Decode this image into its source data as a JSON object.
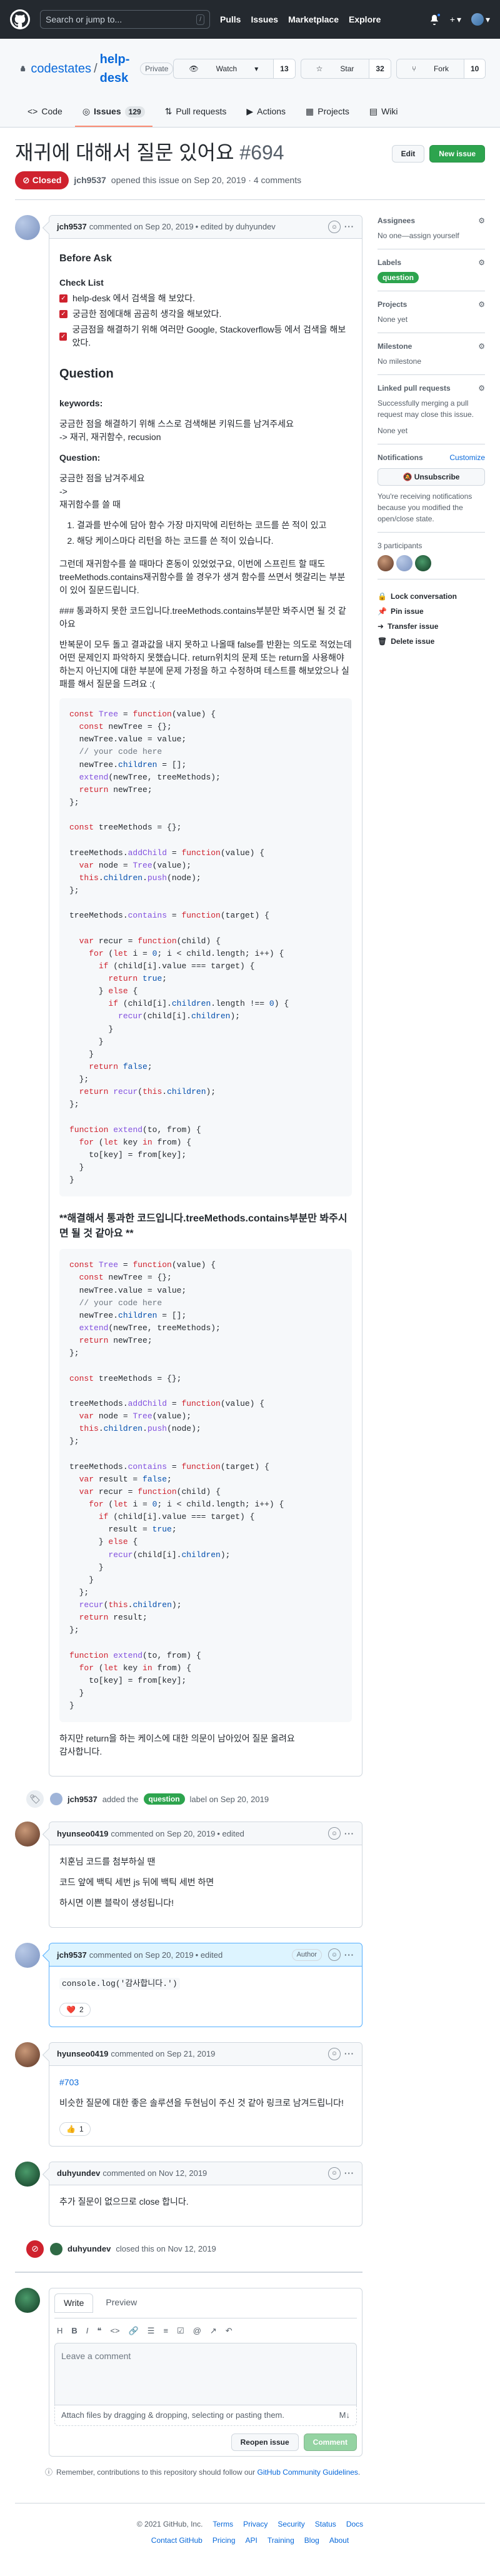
{
  "header": {
    "search_placeholder": "Search or jump to...",
    "search_shortcut": "/",
    "nav": [
      "Pulls",
      "Issues",
      "Marketplace",
      "Explore"
    ],
    "plus": "+",
    "caret": "▾"
  },
  "repo": {
    "owner": "codestates",
    "name": "help-desk",
    "visibility": "Private",
    "watch_label": "Watch",
    "watch_count": "13",
    "star_label": "Star",
    "star_count": "32",
    "fork_label": "Fork",
    "fork_count": "10"
  },
  "tabs": [
    {
      "label": "Code"
    },
    {
      "label": "Issues",
      "count": "129"
    },
    {
      "label": "Pull requests"
    },
    {
      "label": "Actions"
    },
    {
      "label": "Projects"
    },
    {
      "label": "Wiki"
    }
  ],
  "issue": {
    "title": "재귀에 대해서 질문 있어요",
    "number": "#694",
    "edit_label": "Edit",
    "new_issue_label": "New issue",
    "state": "Closed",
    "author": "jch9537",
    "meta_text": "opened this issue on Sep 20, 2019 · 4 comments"
  },
  "first_comment": {
    "author": "jch9537",
    "date": "commented on Sep 20, 2019",
    "edited": "• edited by duhyundev",
    "before_ask": "Before Ask",
    "check_list_title": "Check List",
    "checks": [
      "help-desk 에서 검색을 해 보았다.",
      "궁금한 점에대해 곰곰히 생각을 해보았다.",
      "궁금점을 해결하기 위해 여러만 Google, Stackoverflow등 에서 검색을 해보았다."
    ],
    "question_heading": "Question",
    "keywords_label": "keywords:",
    "keywords_line1": "궁금한 점을 해결하기 위해 스스로 검색해본 키워드를 남겨주세요",
    "keywords_line2": "-> 재귀, 재귀함수, recusion",
    "question_label": "Question:",
    "q_line1": "궁금한 점을 남겨주세요",
    "q_line2": "->",
    "q_line3": "재귀함수를 쓸 때",
    "steps": [
      "결과를 반수에 담아 함수 가장 마지막에 리턴하는 코드를 쓴 적이 있고",
      "해당 케이스마다 리턴을 하는 코드를 쓴 적이 있습니다."
    ],
    "para1": "그런데 재귀함수를 쓸 때마다 혼동이 있었었구요, 이번에 스프린트 할 때도 treeMethods.contains재귀함수를 쓸 경우가 생겨 함수를 쓰면서 헷갈리는 부분이 있어 질문드립니다.",
    "para2": "### 통과하지 못한 코드입니다.treeMethods.contains부분만 봐주시면 될 것 같아요",
    "para3": "반복문이 모두 돌고 결과값을 내지 못하고 나올때 false를 반환는 의도로 적었는데 어떤 문제인지 파악하지 못했습니다. return위치의 문제 또는 return을 사용해야하는지 아닌지에 대한 부분에 문제 가정을 하고 수정하며 테스트를 해보았으나 실패를 해서 질문을 드려요 :(",
    "bold_heading": "**해결해서 통과한 코드입니다.treeMethods.contains부분만 봐주시면 될 것 같아요 **",
    "closing": "하지만 return을 하는 케이스에 대한 의문이 남아있어 질문 올려요",
    "thanks": "감사합니다."
  },
  "events": {
    "labeled_actor": "jch9537",
    "labeled_text1": "added the",
    "labeled_label": "question",
    "labeled_text2": "label on Sep 20, 2019",
    "closed_actor": "duhyundev",
    "closed_text": "closed this on Nov 12, 2019"
  },
  "comments": [
    {
      "author": "hyunseo0419",
      "date": "commented on Sep 20, 2019",
      "edited": "• edited",
      "lines": [
        "치훈님 코드를 첨부하실 땐",
        "코드 앞에 백틱 세번 js 뒤에 백틱 세번 하면",
        "하시면 이쁜 블락이 생성됩니다!"
      ]
    },
    {
      "author": "jch9537",
      "date": "commented on Sep 20, 2019",
      "edited": "• edited",
      "badge": "Author",
      "code": "console.log('감사합니다.')",
      "reaction_emoji": "❤️",
      "reaction_count": "2"
    },
    {
      "author": "hyunseo0419",
      "date": "commented on Sep 21, 2019",
      "link": "#703",
      "text": "비슷한 질문에 대한 좋은 솔루션을 두현님이 주신 것 같아 링크로 남겨드립니다!",
      "reaction_emoji": "👍",
      "reaction_count": "1"
    },
    {
      "author": "duhyundev",
      "date": "commented on Nov 12, 2019",
      "text": "추가 질문이 없으므로 close 합니다."
    }
  ],
  "composer": {
    "write": "Write",
    "preview": "Preview",
    "placeholder": "Leave a comment",
    "attach": "Attach files by dragging & dropping, selecting or pasting them.",
    "md": "M↓",
    "reopen": "Reopen issue",
    "comment": "Comment",
    "remember_pre": "Remember, contributions to this repository should follow our",
    "remember_link": "GitHub Community Guidelines",
    "remember_post": "."
  },
  "sidebar": {
    "assignees_title": "Assignees",
    "assignees_value": "No one—assign yourself",
    "labels_title": "Labels",
    "label_value": "question",
    "projects_title": "Projects",
    "projects_value": "None yet",
    "milestone_title": "Milestone",
    "milestone_value": "No milestone",
    "linked_title": "Linked pull requests",
    "linked_desc": "Successfully merging a pull request may close this issue.",
    "linked_value": "None yet",
    "notifications_title": "Notifications",
    "customize": "Customize",
    "unsubscribe": "Unsubscribe",
    "notif_desc": "You're receiving notifications because you modified the open/close state.",
    "participants": "3 participants",
    "lock": "Lock conversation",
    "pin": "Pin issue",
    "transfer": "Transfer issue",
    "delete": "Delete issue"
  },
  "footer": {
    "copyright": "© 2021 GitHub, Inc.",
    "row1": [
      "Terms",
      "Privacy",
      "Security",
      "Status",
      "Docs"
    ],
    "row2": [
      "Contact GitHub",
      "Pricing",
      "API",
      "Training",
      "Blog",
      "About"
    ]
  },
  "colors": {
    "closed": "#cf222e",
    "question_label": "#2da44e",
    "header_bg": "#24292f"
  }
}
